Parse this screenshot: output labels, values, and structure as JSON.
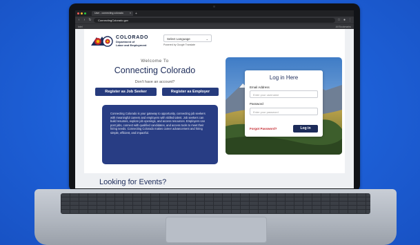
{
  "browser": {
    "tab_title": "User - connecting colorado",
    "tab_close": "×",
    "new_tab": "+",
    "url": "ConnectingColorado.gov",
    "bookmarks_left": "Intel",
    "bookmarks_right": "All Bookmarks"
  },
  "header": {
    "logo_title": "COLORADO",
    "logo_sub1": "Department of",
    "logo_sub2": "Labor and Employment",
    "language_select": "Select Language",
    "powered_by": "Powered by Google Translate"
  },
  "main": {
    "welcome": "Welcome To",
    "title": "Connecting Colorado",
    "no_account": "Don't have an account?",
    "register_job_seeker": "Register as Job Seeker",
    "register_employer": "Register as Employer",
    "info_text": "Connecting Colorado is your gateway to opportunity, connecting job seekers with meaningful careers and employers with skilled talent. Job seekers can build resumes, explore job openings, and access resources. Employers can post jobs, connect with qualified candidates, and access tools to meet their hiring needs. Connecting Colorado makes career advancement and hiring simple, efficient, and impactful."
  },
  "login": {
    "title": "Log in Here",
    "email_label": "Email Address",
    "email_placeholder": "Enter your username",
    "password_label": "Password",
    "password_placeholder": "Enter your password",
    "forgot": "Forgot Password?",
    "button": "Log in"
  },
  "events": {
    "heading": "Looking for Events?"
  },
  "colors": {
    "navy": "#1c2b59",
    "button_blue": "#263b7d",
    "forgot_red": "#c3262d",
    "background_blue": "#1f63d8"
  }
}
